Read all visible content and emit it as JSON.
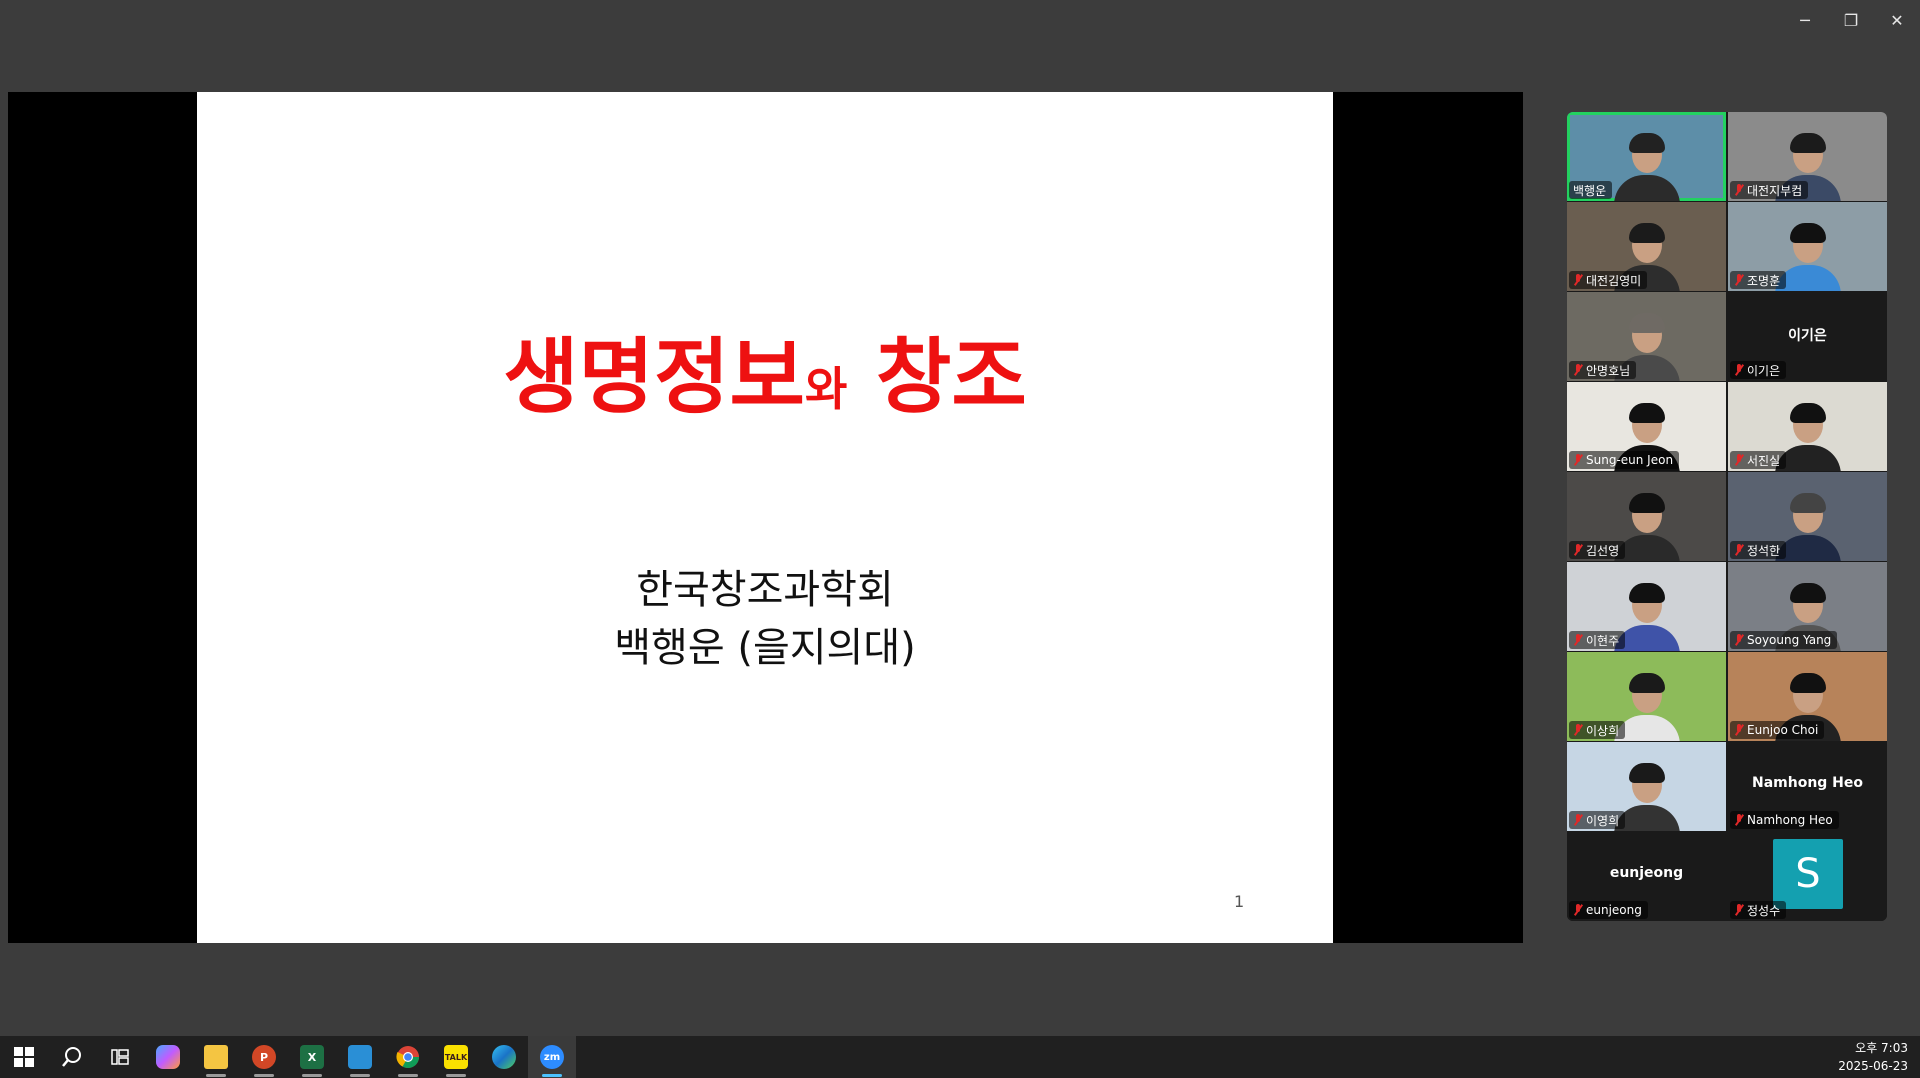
{
  "window": {
    "minimize_label": "─",
    "restore_label": "❐",
    "close_label": "✕"
  },
  "slide": {
    "title_main": "생명정보",
    "title_small": "와",
    "title_end": "창조",
    "subtitle_line1": "한국창조과학회",
    "subtitle_line2": "백행운 (을지의대)",
    "page_number": "1"
  },
  "participants": [
    {
      "name": "백행운",
      "muted": false,
      "video": true,
      "active": true
    },
    {
      "name": "대전지부컴",
      "muted": true,
      "video": true
    },
    {
      "name": "대전김영미",
      "muted": true,
      "video": true
    },
    {
      "name": "조명훈",
      "muted": true,
      "video": true
    },
    {
      "name": "안명호님",
      "muted": true,
      "video": true
    },
    {
      "name": "이기은",
      "muted": true,
      "video": false,
      "display": "이기은"
    },
    {
      "name": "Sung-eun Jeon",
      "muted": true,
      "video": true
    },
    {
      "name": "서진실",
      "muted": true,
      "video": true
    },
    {
      "name": "김선영",
      "muted": true,
      "video": true
    },
    {
      "name": "정석한",
      "muted": true,
      "video": true
    },
    {
      "name": "이현주",
      "muted": true,
      "video": true
    },
    {
      "name": "Soyoung Yang",
      "muted": true,
      "video": true
    },
    {
      "name": "이상희",
      "muted": true,
      "video": true
    },
    {
      "name": "Eunjoo Choi",
      "muted": true,
      "video": true
    },
    {
      "name": "이영희",
      "muted": true,
      "video": true
    },
    {
      "name": "Namhong Heo",
      "muted": true,
      "video": false,
      "display": "Namhong Heo"
    },
    {
      "name": "eunjeong",
      "muted": true,
      "video": false,
      "display": "eunjeong"
    },
    {
      "name": "정성수",
      "muted": true,
      "video": false,
      "avatar_letter": "S"
    }
  ],
  "taskbar": {
    "apps": [
      "start-icon",
      "search-icon",
      "task-view-icon",
      "copilot-icon",
      "file-explorer-icon",
      "powerpoint-icon",
      "excel-icon",
      "hangul-icon",
      "chrome-icon",
      "kakaotalk-icon",
      "edge-icon",
      "zoom-icon"
    ],
    "kakao_label": "TALK",
    "zoom_label": "zm",
    "ppt_label": "P",
    "excel_label": "X"
  },
  "clock": {
    "time": "오후 7:03",
    "date": "2025-06-23"
  },
  "colors": {
    "title_red": "#ee1111",
    "active_border": "#23d160",
    "muted_red": "#e02828",
    "avatar_teal": "#14a0b0"
  }
}
